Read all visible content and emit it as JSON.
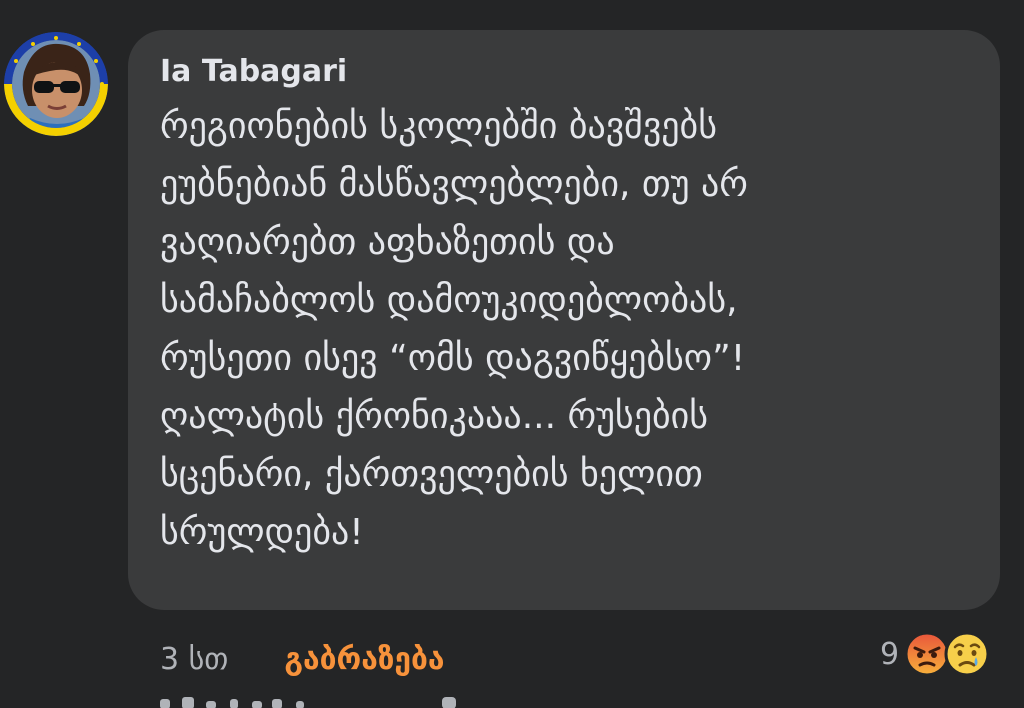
{
  "comment": {
    "author": "Ia Tabagari",
    "lines": [
      "რეგიონების სკოლებში ბავშვებს",
      "ეუბნებიან მასწავლებლები, თუ არ",
      "ვაღიარებთ აფხაზეთის და",
      "სამაჩაბლოს დამოუკიდებლობას,",
      "რუსეთი ისევ “ომს დაგვიწყებსო”!",
      "ღალატის ქრონიკააა... რუსების",
      "სცენარი, ქართველების ხელით",
      "სრულდება!"
    ]
  },
  "meta": {
    "timestamp": "3 სთ",
    "reaction_action": "გაბრაზება"
  },
  "reactions": {
    "count": "9",
    "icons": [
      "angry-face",
      "sad-face"
    ]
  },
  "colors": {
    "background": "#242526",
    "bubble": "#3a3b3c",
    "text": "#e4e6eb",
    "muted": "#b0b3b8",
    "angry_orange": "#f7923b"
  }
}
